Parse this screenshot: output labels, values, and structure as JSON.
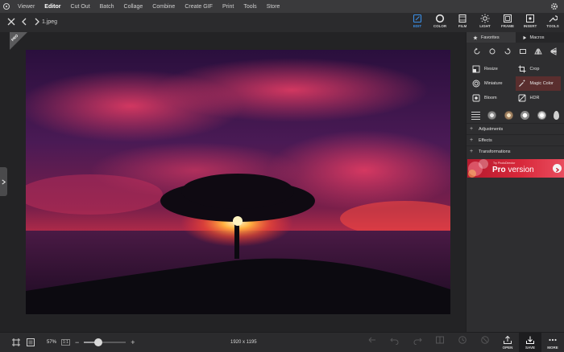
{
  "menu": {
    "items": [
      "Viewer",
      "Editor",
      "Cut Out",
      "Batch",
      "Collage",
      "Combine",
      "Create GIF",
      "Print",
      "Tools",
      "Store"
    ],
    "active_index": 1
  },
  "toolbar": {
    "filename": "1.jpeg",
    "modes": [
      {
        "label": "EDIT",
        "icon": "edit-icon",
        "active": true
      },
      {
        "label": "COLOR",
        "icon": "color-icon",
        "active": false
      },
      {
        "label": "FILM",
        "icon": "film-icon",
        "active": false
      },
      {
        "label": "LIGHT",
        "icon": "light-icon",
        "active": false
      },
      {
        "label": "FRAME",
        "icon": "frame-icon",
        "active": false
      },
      {
        "label": "INSERT",
        "icon": "insert-icon",
        "active": false
      },
      {
        "label": "TOOLS",
        "icon": "tools-icon",
        "active": false
      }
    ]
  },
  "workspace": {
    "pro_badge": "PRO"
  },
  "panel": {
    "tabs": {
      "favorites": "Favorites",
      "macros": "Macros"
    },
    "tools": [
      {
        "label": "Resize",
        "icon": "resize-icon",
        "highlight": false
      },
      {
        "label": "Crop",
        "icon": "crop-icon",
        "highlight": false
      },
      {
        "label": "Miniature",
        "icon": "miniature-icon",
        "highlight": false
      },
      {
        "label": "Magic Color",
        "icon": "magic-wand-icon",
        "highlight": true
      },
      {
        "label": "Bloom",
        "icon": "bloom-icon",
        "highlight": false
      },
      {
        "label": "HDR",
        "icon": "hdr-icon",
        "highlight": false
      }
    ],
    "sections": [
      "Adjustments",
      "Effects",
      "Transformations"
    ],
    "promo": {
      "small": "Try PhotoDirector",
      "prefix": "Pro",
      "suffix": " version"
    }
  },
  "bottom": {
    "zoom": "57%",
    "ratio": "1:1",
    "zoom_fraction": 0.35,
    "minus": "−",
    "plus": "+",
    "dimensions": "1920 x 1195",
    "actions": [
      {
        "label": "",
        "icon": "undo-all-icon",
        "dim": true
      },
      {
        "label": "",
        "icon": "undo-icon",
        "dim": true
      },
      {
        "label": "",
        "icon": "redo-icon",
        "dim": true
      },
      {
        "label": "",
        "icon": "compare-icon",
        "dim": true
      },
      {
        "label": "",
        "icon": "history-icon",
        "dim": true
      },
      {
        "label": "",
        "icon": "cancel-icon",
        "dim": true
      },
      {
        "label": "OPEN",
        "icon": "open-icon",
        "dim": false
      },
      {
        "label": "SAVE",
        "icon": "save-icon",
        "dim": false
      },
      {
        "label": "MORE",
        "icon": "more-icon",
        "dim": false
      }
    ]
  },
  "colors": {
    "accent": "#3b8fe6",
    "highlight": "#5a2e2e"
  }
}
